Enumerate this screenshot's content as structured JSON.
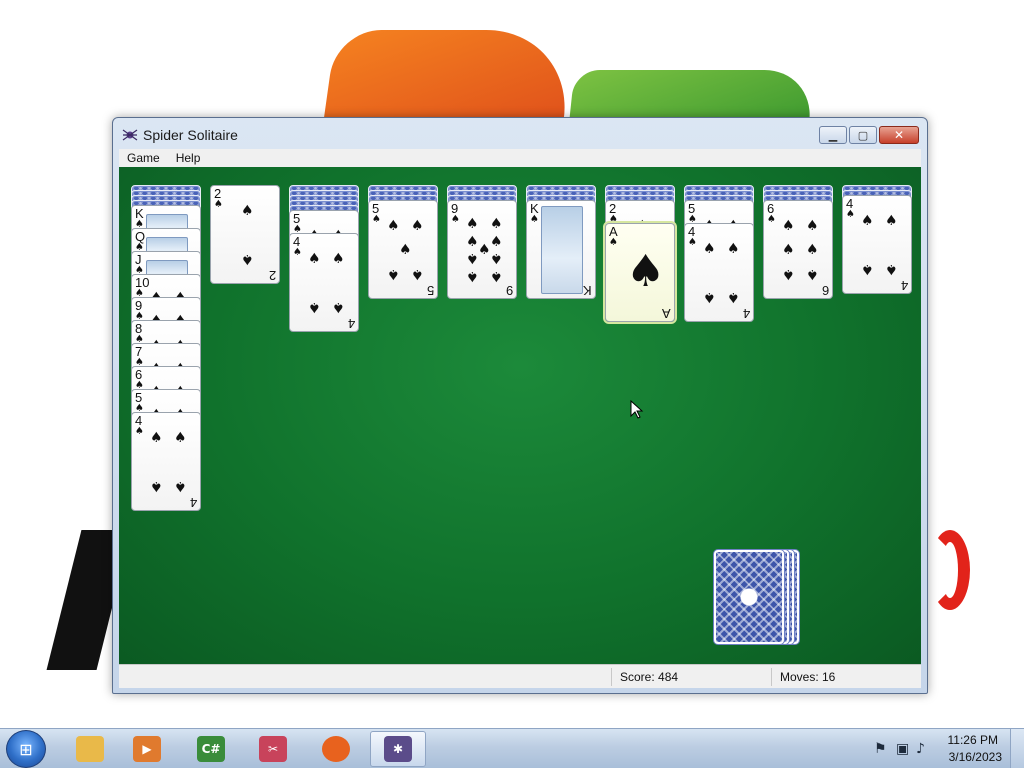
{
  "window": {
    "title": "Spider Solitaire",
    "app_icon": "spider-icon",
    "controls": {
      "minimize": "minimize-icon",
      "maximize": "maximize-icon",
      "close": "close-icon"
    }
  },
  "menu": {
    "items": [
      "Game",
      "Help"
    ]
  },
  "status": {
    "score_label": "Score: 484",
    "moves_label": "Moves:  16"
  },
  "tableau": [
    {
      "hidden": 4,
      "faceup": [
        "K",
        "Q",
        "J",
        "10",
        "9",
        "8",
        "7",
        "6",
        "5",
        "4"
      ]
    },
    {
      "hidden": 0,
      "faceup": [
        "2"
      ]
    },
    {
      "hidden": 5,
      "faceup": [
        "5",
        "4"
      ]
    },
    {
      "hidden": 3,
      "faceup": [
        "5"
      ]
    },
    {
      "hidden": 3,
      "faceup": [
        "9"
      ]
    },
    {
      "hidden": 3,
      "faceup": [
        "K"
      ]
    },
    {
      "hidden": 3,
      "faceup": [
        "2",
        "A"
      ]
    },
    {
      "hidden": 3,
      "faceup": [
        "5",
        "4"
      ]
    },
    {
      "hidden": 3,
      "faceup": [
        "6"
      ]
    },
    {
      "hidden": 2,
      "faceup": [
        "4"
      ]
    }
  ],
  "suit": "♠",
  "stock_piles": 4,
  "selected_card": {
    "column": 6,
    "rank": "A"
  },
  "taskbar": {
    "apps": [
      {
        "name": "file-explorer-icon",
        "glyph": "",
        "color": "#e9b949"
      },
      {
        "name": "media-player-icon",
        "glyph": "▶",
        "color": "#e07a2e"
      },
      {
        "name": "csharp-icon",
        "glyph": "C#",
        "color": "#3a8c3a"
      },
      {
        "name": "snipping-tool-icon",
        "glyph": "✂",
        "color": "#c8435b"
      },
      {
        "name": "firefox-icon",
        "glyph": "",
        "color": "#e8621e"
      },
      {
        "name": "spider-solitaire-icon",
        "glyph": "✱",
        "color": "#5b4c8a"
      }
    ],
    "time": "11:26 PM",
    "date": "3/16/2023"
  }
}
